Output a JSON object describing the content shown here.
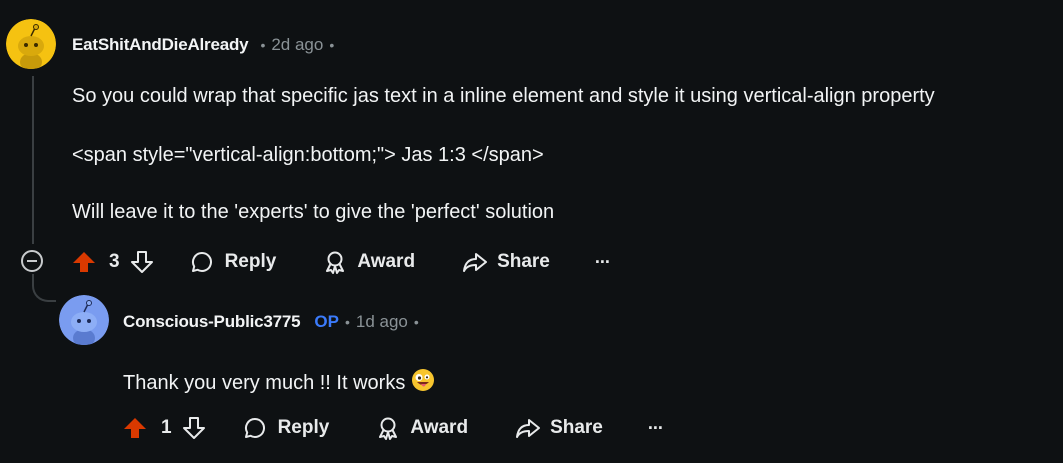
{
  "comment1": {
    "username": "EatShitAndDieAlready",
    "time": "2d ago",
    "lines": [
      "So you could wrap that specific jas text in a inline element and style it using vertical-align property",
      "<span style=\"vertical-align:bottom;\"> Jas 1:3 </span>",
      "Will leave it to the 'experts' to give the 'perfect' solution"
    ],
    "votes": "3",
    "reply_label": "Reply",
    "award_label": "Award",
    "share_label": "Share",
    "more_label": "···"
  },
  "comment2": {
    "username": "Conscious-Public3775",
    "op_badge": "OP",
    "time": "1d ago",
    "text": "Thank you very much !! It works",
    "votes": "1",
    "reply_label": "Reply",
    "award_label": "Award",
    "share_label": "Share",
    "more_label": "···"
  },
  "icons": {
    "upvote": "upvote-arrow-icon",
    "downvote": "downvote-arrow-icon",
    "reply": "speech-bubble-icon",
    "award": "award-ribbon-icon",
    "share": "share-arrow-icon",
    "collapse": "minus-circle-icon",
    "emoji": "zany-face-emoji"
  },
  "colors": {
    "background": "#0e1113",
    "upvote_active": "#d93900",
    "op": "#3b7bfb",
    "muted": "#8a9296",
    "avatar1": "#f5c211",
    "avatar2": "#7a9cf0"
  }
}
